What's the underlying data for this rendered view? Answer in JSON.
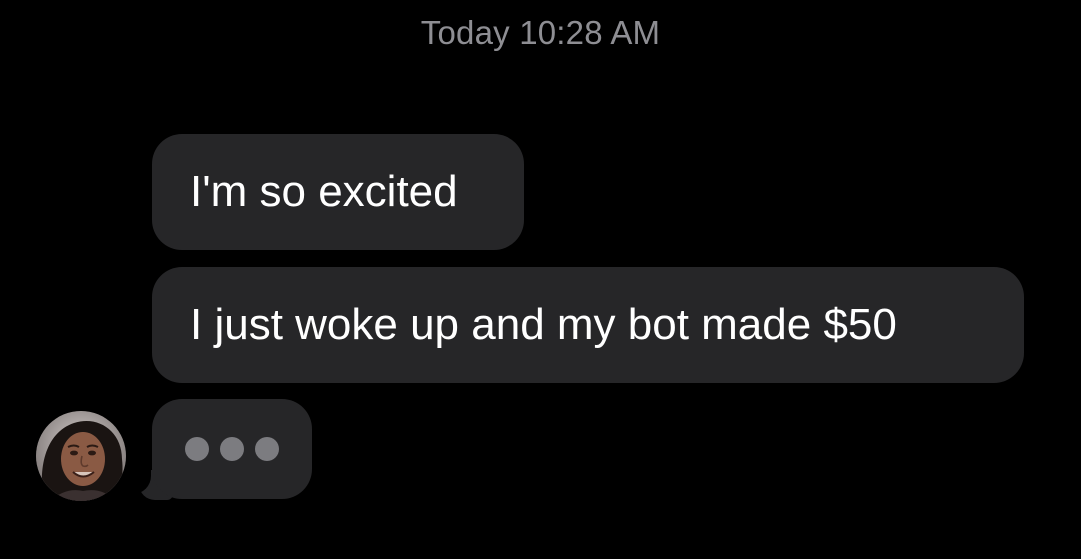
{
  "conversation": {
    "timestamp": "Today 10:28 AM",
    "messages": [
      {
        "text": "I'm so excited"
      },
      {
        "text": "I just woke up and my bot made $50"
      }
    ],
    "typing_indicator": {
      "dots": 3
    },
    "avatar": {
      "icon": "contact-avatar-photo"
    }
  },
  "colors": {
    "background": "#000000",
    "bubble": "#262628",
    "timestamp_text": "#8e8e93",
    "message_text": "#ffffff",
    "typing_dot": "#7c7c80"
  }
}
